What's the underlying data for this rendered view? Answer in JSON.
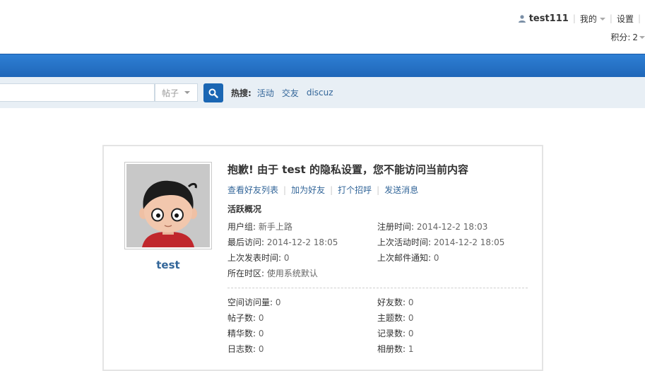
{
  "topbar": {
    "username": "test111",
    "my_label": "我的",
    "settings_label": "设置",
    "credits_label": "积分:",
    "credits_value": "2"
  },
  "search": {
    "type_label": "帖子",
    "hot_label": "热搜:",
    "hot_links": [
      "活动",
      "交友",
      "discuz"
    ]
  },
  "profile": {
    "name": "test",
    "notice": "抱歉! 由于 test 的隐私设置，您不能访问当前内容",
    "actions": [
      "查看好友列表",
      "加为好友",
      "打个招呼",
      "发送消息"
    ],
    "section_title": "活跃概况",
    "stats_top": [
      [
        {
          "label": "用户组:",
          "value": "新手上路"
        },
        {
          "label": "注册时间:",
          "value": "2014-12-2 18:03"
        }
      ],
      [
        {
          "label": "最后访问:",
          "value": "2014-12-2 18:05"
        },
        {
          "label": "上次活动时间:",
          "value": "2014-12-2 18:05"
        }
      ],
      [
        {
          "label": "上次发表时间:",
          "value": "0"
        },
        {
          "label": "上次邮件通知:",
          "value": "0"
        }
      ],
      [
        {
          "label": "所在时区:",
          "value": "使用系统默认"
        },
        null
      ]
    ],
    "stats_bottom": [
      [
        {
          "label": "空间访问量:",
          "value": "0"
        },
        {
          "label": "好友数:",
          "value": "0"
        }
      ],
      [
        {
          "label": "帖子数:",
          "value": "0"
        },
        {
          "label": "主题数:",
          "value": "0"
        }
      ],
      [
        {
          "label": "精华数:",
          "value": "0"
        },
        {
          "label": "记录数:",
          "value": "0"
        }
      ],
      [
        {
          "label": "日志数:",
          "value": "0"
        },
        {
          "label": "相册数:",
          "value": "1"
        }
      ]
    ]
  },
  "colors": {
    "nav_blue": "#1f66b8",
    "link_blue": "#336699",
    "search_bg": "#e8eff5"
  }
}
